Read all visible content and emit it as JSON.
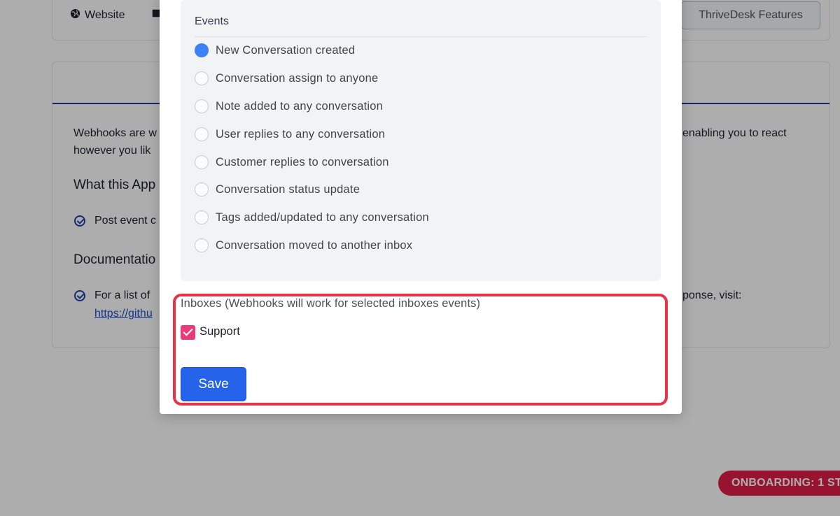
{
  "background": {
    "top_links": {
      "website_label": "Website",
      "features_button": "ThriveDesk Features"
    },
    "intro_line1_left": "Webhooks are w",
    "intro_line1_right": "enabling you to react",
    "intro_line2": "however you lik",
    "what_heading": "What this App",
    "post_event_text": "Post event c",
    "documentation_heading": "Documentatio",
    "doc_text_left": "For a list of",
    "doc_text_right": "ponse, visit:",
    "doc_link": "https://githu",
    "onboarding_label": "ONBOARDING: 1 ST"
  },
  "modal": {
    "events": {
      "title": "Events",
      "items": [
        {
          "label": "New Conversation created",
          "checked": true
        },
        {
          "label": "Conversation assign to anyone",
          "checked": false
        },
        {
          "label": "Note added to any conversation",
          "checked": false
        },
        {
          "label": "User replies to any conversation",
          "checked": false
        },
        {
          "label": "Customer replies to conversation",
          "checked": false
        },
        {
          "label": "Conversation status update",
          "checked": false
        },
        {
          "label": "Tags added/updated to any conversation",
          "checked": false
        },
        {
          "label": "Conversation moved to another inbox",
          "checked": false
        }
      ]
    },
    "inboxes": {
      "label": "Inboxes (Webhooks will work for selected inboxes events)",
      "items": [
        {
          "label": "Support",
          "checked": true
        }
      ]
    },
    "save_label": "Save"
  },
  "colors": {
    "primary": "#2563eb",
    "checkbox_accent": "#e93a7a",
    "highlight": "#e6334a",
    "onboarding": "#e11d48"
  }
}
